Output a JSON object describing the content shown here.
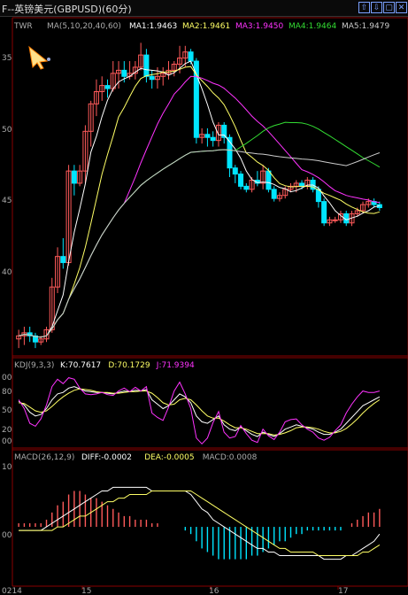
{
  "window": {
    "title": "F--英镑美元(GBPUSD)(60分)",
    "buttons": [
      "⇧",
      "⇩",
      "▢",
      "✕"
    ]
  },
  "colors": {
    "up": "#ff5a5a",
    "down": "#00e5ff",
    "ma1": "#ffffff",
    "ma2": "#ffff66",
    "ma3": "#ff33ff",
    "ma4": "#33dd33",
    "ma5": "#cccccc",
    "grid": "#8a0000"
  },
  "main_panel": {
    "label": "TWR",
    "ma_header": "MA(5,10,20,40,60)",
    "ma_items": [
      {
        "text": "MA1:1.9463",
        "color": "#ffffff"
      },
      {
        "text": "MA2:1.9461",
        "color": "#ffff66"
      },
      {
        "text": "MA3:1.9450",
        "color": "#ff33ff"
      },
      {
        "text": "MA4:1.9464",
        "color": "#33dd33"
      },
      {
        "text": "MA5:1.9479",
        "color": "#cccccc"
      }
    ],
    "y_ticks": [
      "35",
      "50",
      "45",
      "40"
    ]
  },
  "kdj_panel": {
    "header": "KDJ(9,3,3)",
    "items": [
      {
        "text": "K:70.7617",
        "color": "#ffffff"
      },
      {
        "text": "D:70.1729",
        "color": "#ffff66"
      },
      {
        "text": "J:71.9394",
        "color": "#ff33ff"
      }
    ],
    "y_ticks": [
      "00",
      "80",
      "50",
      "20",
      "00"
    ]
  },
  "macd_panel": {
    "header": "MACD(26,12,9)",
    "items": [
      {
        "text": "DIFF:-0.0002",
        "color": "#ffffff"
      },
      {
        "text": "DEA:-0.0005",
        "color": "#ffff66"
      },
      {
        "text": "MACD:0.0008",
        "color": "#aaaaaa"
      }
    ],
    "y_ticks": [
      "10",
      "00"
    ]
  },
  "x_axis": {
    "ticks": [
      "0214",
      "15",
      "16",
      "17"
    ]
  },
  "chart_data": [
    {
      "type": "candlestick",
      "title": "英镑美元(GBPUSD)(60分)",
      "candles": [
        [
          1.9395,
          1.9398,
          1.9392,
          1.9396
        ],
        [
          1.9396,
          1.9399,
          1.9393,
          1.9397
        ],
        [
          1.9397,
          1.9399,
          1.9394,
          1.9396
        ],
        [
          1.9396,
          1.9397,
          1.9392,
          1.9394
        ],
        [
          1.9394,
          1.9396,
          1.9393,
          1.9395
        ],
        [
          1.9395,
          1.9399,
          1.9394,
          1.9398
        ],
        [
          1.9398,
          1.9415,
          1.9397,
          1.9412
        ],
        [
          1.9412,
          1.9425,
          1.941,
          1.9422
        ],
        [
          1.9422,
          1.9428,
          1.9418,
          1.942
        ],
        [
          1.942,
          1.9452,
          1.9419,
          1.945
        ],
        [
          1.945,
          1.9452,
          1.9442,
          1.9446
        ],
        [
          1.9446,
          1.9452,
          1.9445,
          1.945
        ],
        [
          1.945,
          1.9465,
          1.9446,
          1.9463
        ],
        [
          1.9463,
          1.9473,
          1.9458,
          1.9472
        ],
        [
          1.9472,
          1.948,
          1.9468,
          1.9476
        ],
        [
          1.9476,
          1.9481,
          1.9473,
          1.9478
        ],
        [
          1.9478,
          1.948,
          1.9474,
          1.9477
        ],
        [
          1.9477,
          1.9486,
          1.9476,
          1.9482
        ],
        [
          1.9482,
          1.9486,
          1.9477,
          1.9483
        ],
        [
          1.9483,
          1.9486,
          1.9479,
          1.9481
        ],
        [
          1.9481,
          1.9486,
          1.948,
          1.9482
        ],
        [
          1.9482,
          1.9486,
          1.948,
          1.9484
        ],
        [
          1.9484,
          1.9492,
          1.9483,
          1.9488
        ],
        [
          1.9488,
          1.949,
          1.9479,
          1.9481
        ],
        [
          1.9481,
          1.9483,
          1.9477,
          1.948
        ],
        [
          1.948,
          1.9484,
          1.9477,
          1.9481
        ],
        [
          1.9481,
          1.9484,
          1.9478,
          1.9482
        ],
        [
          1.9482,
          1.9486,
          1.948,
          1.9483
        ],
        [
          1.9483,
          1.9486,
          1.9481,
          1.9485
        ],
        [
          1.9485,
          1.9491,
          1.9482,
          1.9487
        ],
        [
          1.9487,
          1.9491,
          1.9484,
          1.9489
        ],
        [
          1.9489,
          1.949,
          1.9485,
          1.9486
        ],
        [
          1.9486,
          1.9487,
          1.9459,
          1.9461
        ],
        [
          1.9461,
          1.9464,
          1.9459,
          1.9462
        ],
        [
          1.9462,
          1.9464,
          1.9458,
          1.9461
        ],
        [
          1.9461,
          1.9463,
          1.9458,
          1.946
        ],
        [
          1.946,
          1.9466,
          1.9458,
          1.9465
        ],
        [
          1.9465,
          1.9466,
          1.9459,
          1.9461
        ],
        [
          1.9461,
          1.9462,
          1.9448,
          1.9451
        ],
        [
          1.9451,
          1.9452,
          1.9446,
          1.9449
        ],
        [
          1.9449,
          1.945,
          1.9444,
          1.9445
        ],
        [
          1.9445,
          1.9446,
          1.9443,
          1.9444
        ],
        [
          1.9444,
          1.9448,
          1.9443,
          1.9447
        ],
        [
          1.9447,
          1.945,
          1.9445,
          1.9446
        ],
        [
          1.9446,
          1.9452,
          1.9444,
          1.945
        ],
        [
          1.945,
          1.9451,
          1.9443,
          1.9444
        ],
        [
          1.9444,
          1.9445,
          1.944,
          1.9441
        ],
        [
          1.9441,
          1.9443,
          1.944,
          1.9442
        ],
        [
          1.9442,
          1.9445,
          1.9441,
          1.9444
        ],
        [
          1.9444,
          1.9446,
          1.9443,
          1.9445
        ],
        [
          1.9445,
          1.9447,
          1.9443,
          1.9446
        ],
        [
          1.9446,
          1.9447,
          1.9444,
          1.9445
        ],
        [
          1.9445,
          1.9448,
          1.9444,
          1.9447
        ],
        [
          1.9447,
          1.9448,
          1.9443,
          1.9444
        ],
        [
          1.9444,
          1.9445,
          1.9438,
          1.944
        ],
        [
          1.944,
          1.9441,
          1.9432,
          1.9433
        ],
        [
          1.9433,
          1.9435,
          1.9432,
          1.9434
        ],
        [
          1.9434,
          1.9435,
          1.9433,
          1.9434
        ],
        [
          1.9434,
          1.9437,
          1.9433,
          1.9436
        ],
        [
          1.9436,
          1.9437,
          1.9432,
          1.9433
        ],
        [
          1.9433,
          1.9437,
          1.9432,
          1.9436
        ],
        [
          1.9436,
          1.9438,
          1.9435,
          1.9437
        ],
        [
          1.9437,
          1.944,
          1.9436,
          1.9439
        ],
        [
          1.9439,
          1.9441,
          1.9438,
          1.944
        ],
        [
          1.944,
          1.9441,
          1.9438,
          1.9439
        ],
        [
          1.9439,
          1.944,
          1.9437,
          1.9438
        ]
      ],
      "ma_series": [
        {
          "name": "MA1",
          "period": 5,
          "color": "#ffffff"
        },
        {
          "name": "MA2",
          "period": 10,
          "color": "#ffff66"
        },
        {
          "name": "MA3",
          "period": 20,
          "color": "#ff33ff"
        },
        {
          "name": "MA4",
          "period": 40,
          "color": "#33dd33"
        },
        {
          "name": "MA5",
          "period": 60,
          "color": "#cccccc"
        }
      ],
      "ylim": [
        1.939,
        1.9495
      ]
    },
    {
      "type": "line",
      "title": "KDJ(9,3,3)",
      "series": [
        {
          "name": "K",
          "color": "#ffffff",
          "values": [
            60,
            55,
            45,
            40,
            42,
            50,
            62,
            70,
            72,
            78,
            80,
            77,
            74,
            73,
            72,
            72,
            71,
            70,
            72,
            74,
            73,
            75,
            74,
            76,
            62,
            56,
            50,
            54,
            62,
            70,
            66,
            58,
            40,
            32,
            30,
            35,
            40,
            28,
            22,
            20,
            25,
            20,
            15,
            12,
            18,
            15,
            12,
            16,
            22,
            25,
            28,
            26,
            24,
            22,
            18,
            15,
            15,
            18,
            22,
            30,
            38,
            46,
            54,
            58,
            62,
            66
          ]
        },
        {
          "name": "D",
          "color": "#ffff66",
          "values": [
            58,
            57,
            52,
            47,
            45,
            47,
            53,
            60,
            66,
            71,
            75,
            77,
            76,
            75,
            73,
            72,
            72,
            71,
            71,
            72,
            73,
            73,
            74,
            74,
            71,
            65,
            58,
            55,
            56,
            62,
            64,
            62,
            55,
            47,
            40,
            37,
            37,
            33,
            28,
            24,
            24,
            22,
            19,
            16,
            16,
            16,
            14,
            15,
            17,
            20,
            24,
            25,
            25,
            24,
            22,
            19,
            17,
            17,
            19,
            23,
            29,
            36,
            44,
            51,
            57,
            62
          ]
        },
        {
          "name": "J",
          "color": "#ff33ff",
          "values": [
            62,
            50,
            30,
            26,
            36,
            55,
            80,
            90,
            84,
            92,
            90,
            78,
            70,
            69,
            70,
            72,
            69,
            68,
            74,
            78,
            73,
            79,
            74,
            80,
            44,
            38,
            34,
            52,
            74,
            86,
            70,
            50,
            10,
            2,
            10,
            31,
            46,
            18,
            10,
            12,
            27,
            16,
            7,
            4,
            22,
            13,
            8,
            18,
            32,
            35,
            36,
            28,
            22,
            18,
            10,
            7,
            11,
            20,
            28,
            44,
            56,
            66,
            74,
            72,
            72,
            74
          ]
        }
      ],
      "ylim": [
        0,
        100
      ]
    },
    {
      "type": "bar",
      "title": "MACD(26,12,9)",
      "series": [
        {
          "name": "DIFF",
          "color": "#ffffff",
          "values": [
            -0.0001,
            -0.0001,
            -0.0001,
            -0.0001,
            -0.0001,
            0.0,
            0.0001,
            0.0002,
            0.0003,
            0.0004,
            0.0005,
            0.0006,
            0.0007,
            0.0008,
            0.0009,
            0.001,
            0.001,
            0.0011,
            0.0011,
            0.0011,
            0.0011,
            0.0011,
            0.0011,
            0.0011,
            0.001,
            0.001,
            0.001,
            0.001,
            0.001,
            0.001,
            0.001,
            0.0009,
            0.0007,
            0.0005,
            0.0004,
            0.0002,
            0.0001,
            0.0,
            -0.0001,
            -0.0002,
            -0.0003,
            -0.0004,
            -0.0005,
            -0.0006,
            -0.0006,
            -0.0007,
            -0.0007,
            -0.0008,
            -0.0008,
            -0.0008,
            -0.0008,
            -0.0008,
            -0.0008,
            -0.0008,
            -0.0008,
            -0.0009,
            -0.0009,
            -0.0009,
            -0.0009,
            -0.0008,
            -0.0008,
            -0.0007,
            -0.0006,
            -0.0005,
            -0.0004,
            -0.0002
          ]
        },
        {
          "name": "DEA",
          "color": "#ffff66",
          "values": [
            -0.0001,
            -0.0001,
            -0.0001,
            -0.0001,
            -0.0001,
            -0.0001,
            -0.0001,
            0.0,
            0.0,
            0.0001,
            0.0002,
            0.0003,
            0.0003,
            0.0004,
            0.0005,
            0.0006,
            0.0007,
            0.0007,
            0.0008,
            0.0008,
            0.0009,
            0.0009,
            0.0009,
            0.0009,
            0.001,
            0.001,
            0.001,
            0.001,
            0.001,
            0.001,
            0.001,
            0.001,
            0.0009,
            0.0008,
            0.0007,
            0.0006,
            0.0005,
            0.0004,
            0.0003,
            0.0002,
            0.0001,
            0.0,
            -0.0001,
            -0.0002,
            -0.0003,
            -0.0004,
            -0.0005,
            -0.0006,
            -0.0006,
            -0.0007,
            -0.0007,
            -0.0007,
            -0.0007,
            -0.0007,
            -0.0008,
            -0.0008,
            -0.0008,
            -0.0008,
            -0.0008,
            -0.0008,
            -0.0008,
            -0.0008,
            -0.0007,
            -0.0007,
            -0.0006,
            -0.0005
          ]
        },
        {
          "name": "MACD",
          "color": "#aaaaaa",
          "values": [
            0.0001,
            0.0001,
            0.0001,
            0.0001,
            0.0001,
            0.0002,
            0.0004,
            0.0006,
            0.0007,
            0.0009,
            0.001,
            0.001,
            0.0009,
            0.0008,
            0.0008,
            0.0007,
            0.0006,
            0.0005,
            0.0004,
            0.0003,
            0.0003,
            0.0002,
            0.0002,
            0.0002,
            0.0001,
            0.0001,
            0.0,
            0.0,
            0.0,
            0.0,
            -0.0001,
            -0.0002,
            -0.0004,
            -0.0006,
            -0.0007,
            -0.0008,
            -0.0009,
            -0.0009,
            -0.0009,
            -0.0009,
            -0.0009,
            -0.0009,
            -0.0008,
            -0.0008,
            -0.0007,
            -0.0006,
            -0.0005,
            -0.0004,
            -0.0004,
            -0.0003,
            -0.0002,
            -0.0002,
            -0.0001,
            -0.0001,
            -0.0001,
            -0.0001,
            -0.0001,
            -0.0001,
            -0.0001,
            0.0,
            0.0001,
            0.0002,
            0.0003,
            0.0004,
            0.0004,
            0.0005
          ]
        }
      ],
      "ylim": [
        -0.0016,
        0.0018
      ]
    }
  ]
}
